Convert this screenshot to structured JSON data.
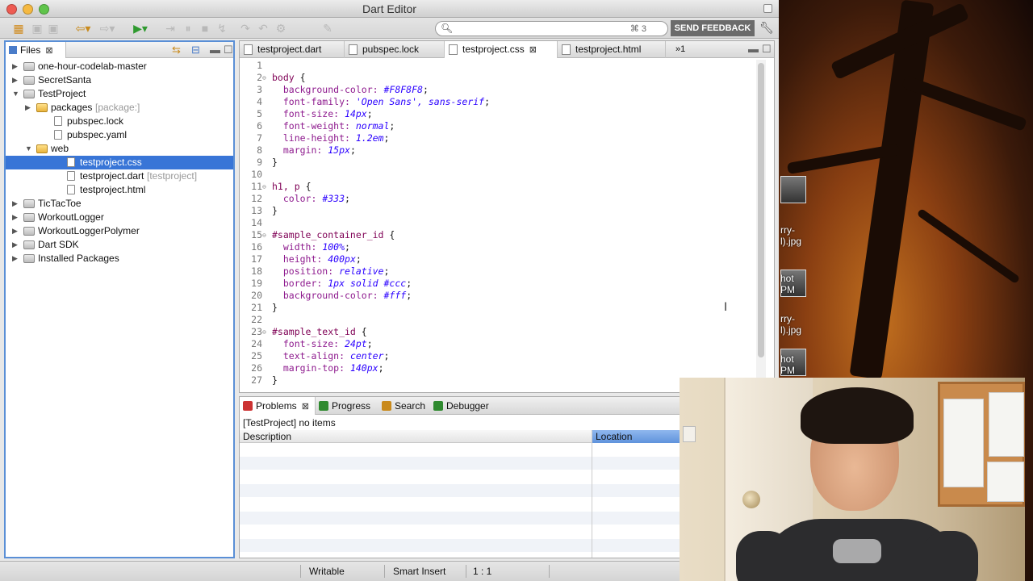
{
  "window": {
    "title": "Dart Editor"
  },
  "toolbar": {
    "search_placeholder": "",
    "search_shortcut": "⌘ 3",
    "feedback_label": "SEND FEEDBACK"
  },
  "files_panel": {
    "tab_label": "Files",
    "tree": [
      {
        "label": "one-hour-codelab-master",
        "suffix": "",
        "depth": 0,
        "kind": "project",
        "expanded": false,
        "selected": false
      },
      {
        "label": "SecretSanta",
        "suffix": "",
        "depth": 0,
        "kind": "project",
        "expanded": false,
        "selected": false
      },
      {
        "label": "TestProject",
        "suffix": "",
        "depth": 0,
        "kind": "project",
        "expanded": true,
        "selected": false
      },
      {
        "label": "packages",
        "suffix": "[package:]",
        "depth": 1,
        "kind": "folder",
        "expanded": false,
        "selected": false
      },
      {
        "label": "pubspec.lock",
        "suffix": "",
        "depth": 1,
        "kind": "file",
        "expanded": null,
        "selected": false
      },
      {
        "label": "pubspec.yaml",
        "suffix": "",
        "depth": 1,
        "kind": "file",
        "expanded": null,
        "selected": false
      },
      {
        "label": "web",
        "suffix": "",
        "depth": 1,
        "kind": "folder",
        "expanded": true,
        "selected": false
      },
      {
        "label": "testproject.css",
        "suffix": "",
        "depth": 2,
        "kind": "file",
        "expanded": null,
        "selected": true
      },
      {
        "label": "testproject.dart",
        "suffix": "[testproject]",
        "depth": 2,
        "kind": "file",
        "expanded": null,
        "selected": false
      },
      {
        "label": "testproject.html",
        "suffix": "",
        "depth": 2,
        "kind": "file",
        "expanded": null,
        "selected": false
      },
      {
        "label": "TicTacToe",
        "suffix": "",
        "depth": 0,
        "kind": "project",
        "expanded": false,
        "selected": false
      },
      {
        "label": "WorkoutLogger",
        "suffix": "",
        "depth": 0,
        "kind": "project",
        "expanded": false,
        "selected": false
      },
      {
        "label": "WorkoutLoggerPolymer",
        "suffix": "",
        "depth": 0,
        "kind": "project",
        "expanded": false,
        "selected": false
      },
      {
        "label": "Dart SDK",
        "suffix": "",
        "depth": 0,
        "kind": "project",
        "expanded": false,
        "selected": false
      },
      {
        "label": "Installed Packages",
        "suffix": "",
        "depth": 0,
        "kind": "project",
        "expanded": false,
        "selected": false
      }
    ]
  },
  "editor": {
    "tabs": [
      {
        "label": "testproject.dart",
        "active": false,
        "closable": false
      },
      {
        "label": "pubspec.lock",
        "active": false,
        "closable": false
      },
      {
        "label": "testproject.css",
        "active": true,
        "closable": true
      },
      {
        "label": "testproject.html",
        "active": false,
        "closable": false
      }
    ],
    "overflow_count": "1",
    "lines": [
      {
        "n": "1",
        "fold": "",
        "parts": []
      },
      {
        "n": "2",
        "fold": "⊖",
        "parts": [
          [
            "sel-k",
            "body"
          ],
          [
            "",
            "{"
          ]
        ]
      },
      {
        "n": "3",
        "fold": "",
        "parts": [
          [
            "prop",
            "  background-color: "
          ],
          [
            "val",
            "#F8F8F8"
          ],
          [
            "",
            ";"
          ]
        ]
      },
      {
        "n": "4",
        "fold": "",
        "parts": [
          [
            "prop",
            "  font-family: "
          ],
          [
            "val",
            "'Open Sans', sans-serif"
          ],
          [
            "",
            ";"
          ]
        ]
      },
      {
        "n": "5",
        "fold": "",
        "parts": [
          [
            "prop",
            "  font-size: "
          ],
          [
            "val",
            "14px"
          ],
          [
            "",
            ";"
          ]
        ]
      },
      {
        "n": "6",
        "fold": "",
        "parts": [
          [
            "prop",
            "  font-weight: "
          ],
          [
            "val",
            "normal"
          ],
          [
            "",
            ";"
          ]
        ]
      },
      {
        "n": "7",
        "fold": "",
        "parts": [
          [
            "prop",
            "  line-height: "
          ],
          [
            "val",
            "1.2em"
          ],
          [
            "",
            ";"
          ]
        ]
      },
      {
        "n": "8",
        "fold": "",
        "parts": [
          [
            "prop",
            "  margin: "
          ],
          [
            "val",
            "15px"
          ],
          [
            "",
            ";"
          ]
        ]
      },
      {
        "n": "9",
        "fold": "",
        "parts": [
          [
            "",
            "}"
          ]
        ]
      },
      {
        "n": "10",
        "fold": "",
        "parts": []
      },
      {
        "n": "11",
        "fold": "⊖",
        "parts": [
          [
            "sel-k",
            "h1, p"
          ],
          [
            "",
            "{"
          ]
        ]
      },
      {
        "n": "12",
        "fold": "",
        "parts": [
          [
            "prop",
            "  color: "
          ],
          [
            "val",
            "#333"
          ],
          [
            "",
            ";"
          ]
        ]
      },
      {
        "n": "13",
        "fold": "",
        "parts": [
          [
            "",
            "}"
          ]
        ]
      },
      {
        "n": "14",
        "fold": "",
        "parts": []
      },
      {
        "n": "15",
        "fold": "⊖",
        "parts": [
          [
            "sel-k",
            "#sample_container_id"
          ],
          [
            "",
            "{"
          ]
        ]
      },
      {
        "n": "16",
        "fold": "",
        "parts": [
          [
            "prop",
            "  width: "
          ],
          [
            "val",
            "100%"
          ],
          [
            "",
            ";"
          ]
        ]
      },
      {
        "n": "17",
        "fold": "",
        "parts": [
          [
            "prop",
            "  height: "
          ],
          [
            "val",
            "400px"
          ],
          [
            "",
            ";"
          ]
        ]
      },
      {
        "n": "18",
        "fold": "",
        "parts": [
          [
            "prop",
            "  position: "
          ],
          [
            "val",
            "relative"
          ],
          [
            "",
            ";"
          ]
        ]
      },
      {
        "n": "19",
        "fold": "",
        "parts": [
          [
            "prop",
            "  border: "
          ],
          [
            "val",
            "1px solid #ccc"
          ],
          [
            "",
            ";"
          ]
        ]
      },
      {
        "n": "20",
        "fold": "",
        "parts": [
          [
            "prop",
            "  background-color: "
          ],
          [
            "val",
            "#fff"
          ],
          [
            "",
            ";"
          ]
        ]
      },
      {
        "n": "21",
        "fold": "",
        "parts": [
          [
            "",
            "}"
          ]
        ]
      },
      {
        "n": "22",
        "fold": "",
        "parts": []
      },
      {
        "n": "23",
        "fold": "⊖",
        "parts": [
          [
            "sel-k",
            "#sample_text_id"
          ],
          [
            "",
            "{"
          ]
        ]
      },
      {
        "n": "24",
        "fold": "",
        "parts": [
          [
            "prop",
            "  font-size: "
          ],
          [
            "val",
            "24pt"
          ],
          [
            "",
            ";"
          ]
        ]
      },
      {
        "n": "25",
        "fold": "",
        "parts": [
          [
            "prop",
            "  text-align: "
          ],
          [
            "val",
            "center"
          ],
          [
            "",
            ";"
          ]
        ]
      },
      {
        "n": "26",
        "fold": "",
        "parts": [
          [
            "prop",
            "  margin-top: "
          ],
          [
            "val",
            "140px"
          ],
          [
            "",
            ";"
          ]
        ]
      },
      {
        "n": "27",
        "fold": "",
        "parts": [
          [
            "",
            "}"
          ]
        ]
      }
    ]
  },
  "bottom_panel": {
    "tabs": [
      {
        "label": "Problems",
        "active": true,
        "icon": "problems-icon"
      },
      {
        "label": "Progress",
        "active": false,
        "icon": "progress-icon"
      },
      {
        "label": "Search",
        "active": false,
        "icon": "search-icon"
      },
      {
        "label": "Debugger",
        "active": false,
        "icon": "debugger-icon"
      }
    ],
    "status": "[TestProject] no items",
    "columns": {
      "description": "Description",
      "location": "Location"
    }
  },
  "statusbar": {
    "writable": "Writable",
    "insert_mode": "Smart Insert",
    "position": "1 : 1"
  },
  "desktop": {
    "labels": [
      "rry-",
      "l).jpg",
      "hot",
      "PM",
      "rry-",
      "l).jpg",
      "hot",
      "PM"
    ]
  },
  "colors": {
    "selection": "#3875d7",
    "panel_border": "#5a8fd6",
    "css_property": "#8e1a8e",
    "css_value": "#2a00ff",
    "css_selector": "#7f0055"
  }
}
